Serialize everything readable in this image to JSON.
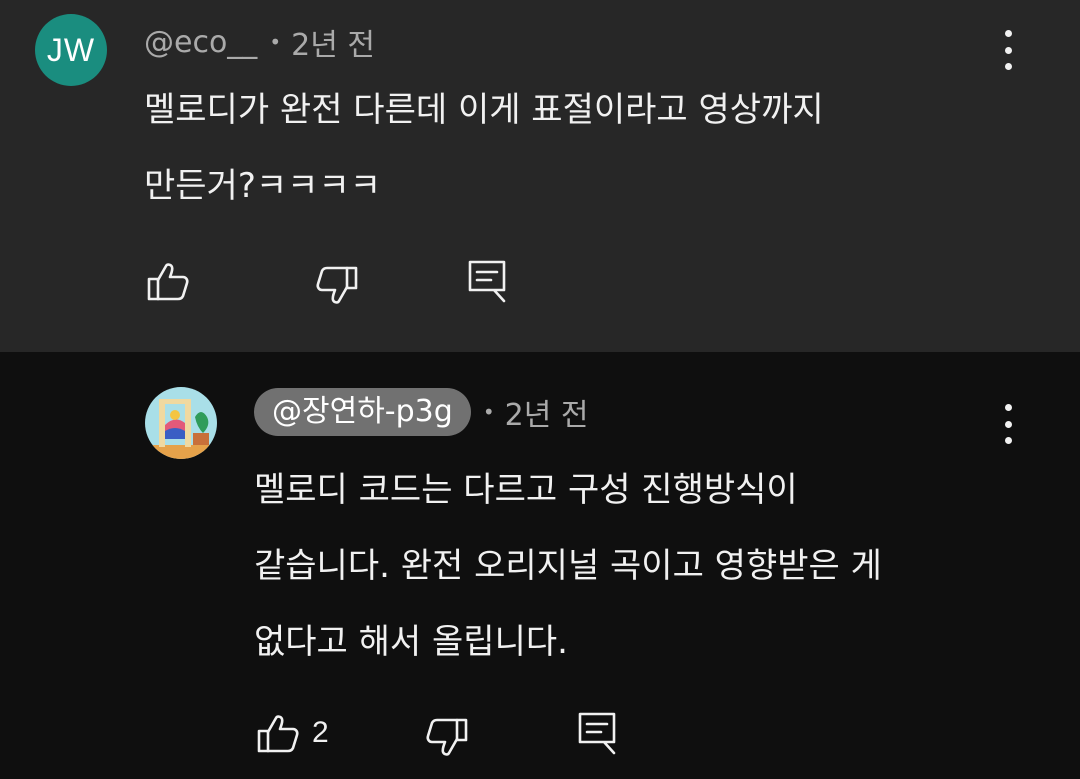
{
  "parent_comment": {
    "avatar_initials": "JW",
    "avatar_color": "#1a8d7f",
    "handle": "@eco__",
    "time": "2년 전",
    "text_line1": "멜로디가 완전 다른데 이게 표절이라고 영상까지",
    "text_line2": "만든거?ㅋㅋㅋㅋ",
    "actions": {
      "like_icon": "thumbs-up-icon",
      "dislike_icon": "thumbs-down-icon",
      "reply_icon": "reply-icon"
    },
    "menu_icon": "more-vertical-icon"
  },
  "reply_comment": {
    "avatar_icon": "illustrated-avatar",
    "handle": "@장연하-p3g",
    "time": "2년 전",
    "text_line1": "멜로디 코드는 다르고 구성 진행방식이",
    "text_line2": "같습니다. 완전 오리지널 곡이고 영향받은 게",
    "text_line3": "없다고 해서 올립니다.",
    "like_count": "2",
    "actions": {
      "like_icon": "thumbs-up-icon",
      "dislike_icon": "thumbs-down-icon",
      "reply_icon": "reply-icon"
    },
    "menu_icon": "more-vertical-icon"
  },
  "colors": {
    "parent_background": "#272727",
    "page_background": "#0f0f0f",
    "text_primary": "#f1f1f1",
    "text_secondary": "#aaaaaa",
    "handle_chip": "#717171"
  }
}
